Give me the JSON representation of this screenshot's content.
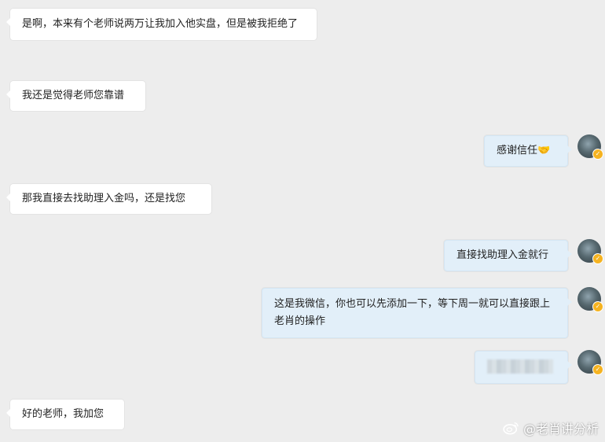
{
  "messages": [
    {
      "side": "left",
      "text": "是啊，本来有个老师说两万让我加入他实盘，但是被我拒绝了"
    },
    {
      "side": "left",
      "text": "我还是觉得老师您靠谱"
    },
    {
      "side": "right",
      "text": "感谢信任🤝"
    },
    {
      "side": "left",
      "text": "那我直接去找助理入金吗，还是找您"
    },
    {
      "side": "right",
      "text": "直接找助理入金就行"
    },
    {
      "side": "right",
      "text": "这是我微信，你也可以先添加一下，等下周一就可以直接跟上老肖的操作"
    },
    {
      "side": "right",
      "text": ""
    },
    {
      "side": "left",
      "text": "好的老师，我加您"
    }
  ],
  "avatar": {
    "badge_icon": "verified-badge-icon",
    "badge_color": "#f5b321"
  },
  "watermark": {
    "text": "@老肖讲分析",
    "icon": "weibo-icon"
  }
}
